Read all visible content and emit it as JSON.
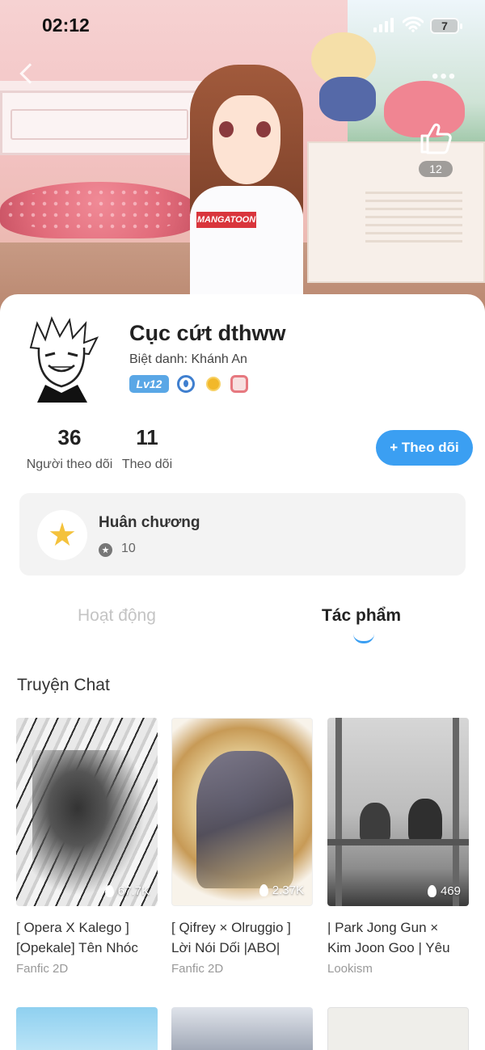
{
  "status_bar": {
    "time": "02:12",
    "battery": "7"
  },
  "banner": {
    "like_count": "12",
    "shirt_logo": "MANGATOON"
  },
  "profile": {
    "name": "Cục cứt dthww",
    "nickname": "Biệt danh: Khánh An",
    "level": "Lv12"
  },
  "stats": {
    "followers_count": "36",
    "followers_label": "Người theo dõi",
    "following_count": "11",
    "following_label": "Theo dõi"
  },
  "follow_button": "+ Theo dõi",
  "medal": {
    "title": "Huân chương",
    "count": "10"
  },
  "tabs": {
    "activity": "Hoạt động",
    "works": "Tác phẩm"
  },
  "section": {
    "title": "Truyện Chat"
  },
  "works": [
    {
      "title": "[ Opera X Kalego ]\n[Opekale] Tên Nhóc",
      "genre": "Fanfic 2D",
      "views": "67.7K"
    },
    {
      "title": "[ Qifrey × Olruggio ]\nLời Nói Dối |ABO|",
      "genre": "Fanfic 2D",
      "views": "2.37K"
    },
    {
      "title": "| Park Jong Gun ×\nKim Joon Goo | Yêu",
      "genre": "Lookism",
      "views": "469"
    }
  ],
  "colors": {
    "accent": "#3b9ff2",
    "level_badge": "#5aa7e6"
  }
}
